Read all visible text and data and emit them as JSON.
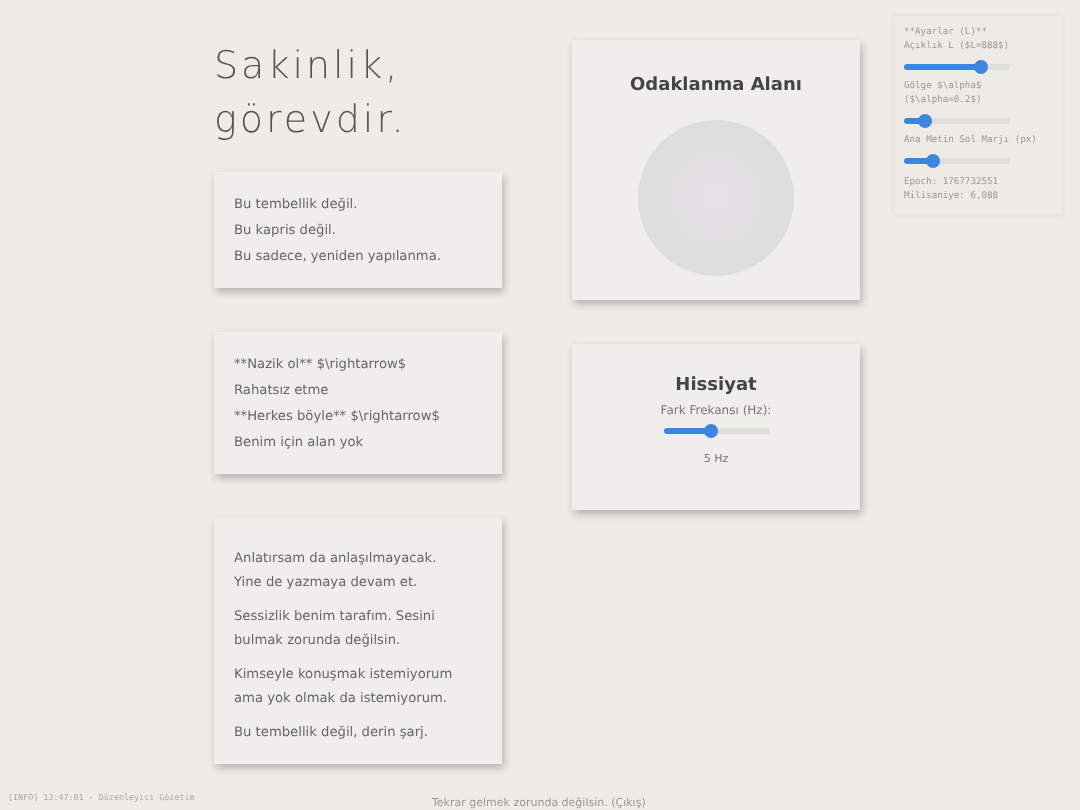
{
  "title_lines": [
    "Sakinlik,",
    "görevdir."
  ],
  "cards": [
    {
      "lines": [
        [
          "Bu tembellik değil."
        ],
        [
          "Bu kapris değil."
        ],
        [
          "Bu sadece, yeniden yapılanma."
        ]
      ]
    },
    {
      "lines": [
        [
          "**Nazik ol** $\\rightarrow$"
        ],
        [
          "Rahatsız etme"
        ],
        [
          "**Herkes böyle** $\\rightarrow$"
        ],
        [
          "Benim için alan yok"
        ]
      ]
    },
    {
      "lines": [
        [
          "Anlatırsam da anlaşılmayacak.",
          "Yine de yazmaya devam et."
        ],
        [
          "Sessizlik benim tarafım. Sesini",
          "bulmak zorunda değilsin."
        ],
        [
          "Kimseyle konuşmak istemiyorum",
          "ama yok olmak da istemiyorum."
        ],
        [
          "Bu tembellik değil, derin şarj."
        ]
      ]
    }
  ],
  "focus": {
    "title": "Odaklanma Alanı"
  },
  "feeling": {
    "title": "Hissiyat",
    "label": "Fark Frekansı (Hz):",
    "level": 0.45,
    "reading": "5 Hz"
  },
  "settings": {
    "heading": "**Ayarlar (L)**",
    "sliders": [
      {
        "label": "Açıklık L ($L=888$)",
        "level": 0.72
      },
      {
        "label": "Gölge $\\alpha$ ($\\alpha=0.2$)",
        "level": 0.2
      },
      {
        "label": "Ana Metin Sol Marjı (px)",
        "level": 0.28
      }
    ],
    "stats": [
      "Epoch: 1767732551",
      "Milisaniye: 6,088"
    ]
  },
  "log": "[INFO] 13:47:01 - Düzenleyici Gözetim",
  "footer": "Tekrar gelmek zorunda değilsin. (Çıkış)"
}
